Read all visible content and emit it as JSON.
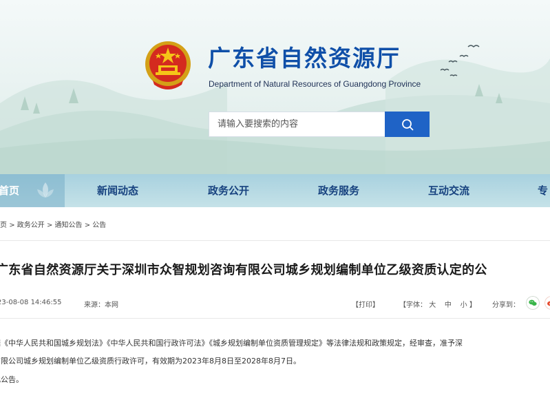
{
  "header": {
    "title": "广东省自然资源厅",
    "subtitle": "Department of Natural Resources of Guangdong Province"
  },
  "search": {
    "placeholder": "请输入要搜索的内容"
  },
  "nav": {
    "items": [
      {
        "label": "首页"
      },
      {
        "label": "新闻动态"
      },
      {
        "label": "政务公开"
      },
      {
        "label": "政务服务"
      },
      {
        "label": "互动交流"
      },
      {
        "label": "专"
      }
    ]
  },
  "breadcrumb": {
    "items": [
      "页",
      "政务公开",
      "通知公告",
      "公告"
    ],
    "separator": ">"
  },
  "article": {
    "title": "广东省自然资源厅关于深圳市众智规划咨询有限公司城乡规划编制单位乙级资质认定的公",
    "date": "23-08-08 14:46:55",
    "source": "来源：本网",
    "print_label": "【打印】",
    "font_size_label": "【字体：",
    "font_large": "大",
    "font_medium": "中",
    "font_small": "小",
    "font_size_close": "】",
    "share_label": "分享到：",
    "paragraphs": [
      "据《中华人民共和国城乡规划法》《中华人民共和国行政许可法》《城乡规划编制单位资质管理规定》等法律法规和政策规定，经审查，准予深",
      "有限公司城乡规划编制单位乙级资质行政许可，有效期为2023年8月8日至2028年8月7日。",
      "此公告。"
    ]
  },
  "colors": {
    "brand_blue": "#0f4fa8",
    "search_button": "#1f63c6",
    "nav_bg": "#b6d9e3",
    "nav_text": "#17427f",
    "wechat": "#39b54a",
    "weibo": "#e64a2e"
  },
  "icons": {
    "emblem": "national-emblem-icon",
    "search": "search-icon",
    "wechat": "wechat-icon",
    "weibo": "weibo-icon"
  }
}
